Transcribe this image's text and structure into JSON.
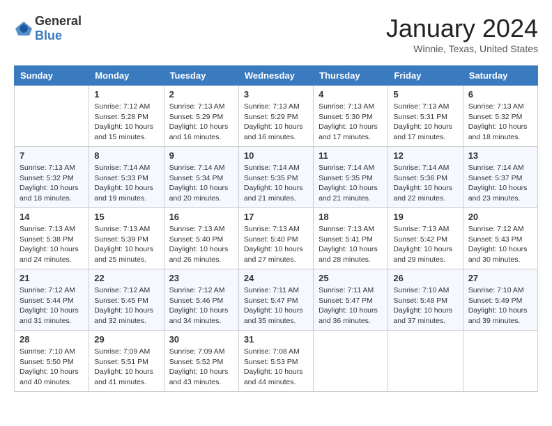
{
  "header": {
    "logo_general": "General",
    "logo_blue": "Blue",
    "month": "January 2024",
    "location": "Winnie, Texas, United States"
  },
  "days_of_week": [
    "Sunday",
    "Monday",
    "Tuesday",
    "Wednesday",
    "Thursday",
    "Friday",
    "Saturday"
  ],
  "weeks": [
    [
      {
        "day": "",
        "info": ""
      },
      {
        "day": "1",
        "info": "Sunrise: 7:12 AM\nSunset: 5:28 PM\nDaylight: 10 hours\nand 15 minutes."
      },
      {
        "day": "2",
        "info": "Sunrise: 7:13 AM\nSunset: 5:29 PM\nDaylight: 10 hours\nand 16 minutes."
      },
      {
        "day": "3",
        "info": "Sunrise: 7:13 AM\nSunset: 5:29 PM\nDaylight: 10 hours\nand 16 minutes."
      },
      {
        "day": "4",
        "info": "Sunrise: 7:13 AM\nSunset: 5:30 PM\nDaylight: 10 hours\nand 17 minutes."
      },
      {
        "day": "5",
        "info": "Sunrise: 7:13 AM\nSunset: 5:31 PM\nDaylight: 10 hours\nand 17 minutes."
      },
      {
        "day": "6",
        "info": "Sunrise: 7:13 AM\nSunset: 5:32 PM\nDaylight: 10 hours\nand 18 minutes."
      }
    ],
    [
      {
        "day": "7",
        "info": "Sunrise: 7:13 AM\nSunset: 5:32 PM\nDaylight: 10 hours\nand 18 minutes."
      },
      {
        "day": "8",
        "info": "Sunrise: 7:14 AM\nSunset: 5:33 PM\nDaylight: 10 hours\nand 19 minutes."
      },
      {
        "day": "9",
        "info": "Sunrise: 7:14 AM\nSunset: 5:34 PM\nDaylight: 10 hours\nand 20 minutes."
      },
      {
        "day": "10",
        "info": "Sunrise: 7:14 AM\nSunset: 5:35 PM\nDaylight: 10 hours\nand 21 minutes."
      },
      {
        "day": "11",
        "info": "Sunrise: 7:14 AM\nSunset: 5:35 PM\nDaylight: 10 hours\nand 21 minutes."
      },
      {
        "day": "12",
        "info": "Sunrise: 7:14 AM\nSunset: 5:36 PM\nDaylight: 10 hours\nand 22 minutes."
      },
      {
        "day": "13",
        "info": "Sunrise: 7:14 AM\nSunset: 5:37 PM\nDaylight: 10 hours\nand 23 minutes."
      }
    ],
    [
      {
        "day": "14",
        "info": "Sunrise: 7:13 AM\nSunset: 5:38 PM\nDaylight: 10 hours\nand 24 minutes."
      },
      {
        "day": "15",
        "info": "Sunrise: 7:13 AM\nSunset: 5:39 PM\nDaylight: 10 hours\nand 25 minutes."
      },
      {
        "day": "16",
        "info": "Sunrise: 7:13 AM\nSunset: 5:40 PM\nDaylight: 10 hours\nand 26 minutes."
      },
      {
        "day": "17",
        "info": "Sunrise: 7:13 AM\nSunset: 5:40 PM\nDaylight: 10 hours\nand 27 minutes."
      },
      {
        "day": "18",
        "info": "Sunrise: 7:13 AM\nSunset: 5:41 PM\nDaylight: 10 hours\nand 28 minutes."
      },
      {
        "day": "19",
        "info": "Sunrise: 7:13 AM\nSunset: 5:42 PM\nDaylight: 10 hours\nand 29 minutes."
      },
      {
        "day": "20",
        "info": "Sunrise: 7:12 AM\nSunset: 5:43 PM\nDaylight: 10 hours\nand 30 minutes."
      }
    ],
    [
      {
        "day": "21",
        "info": "Sunrise: 7:12 AM\nSunset: 5:44 PM\nDaylight: 10 hours\nand 31 minutes."
      },
      {
        "day": "22",
        "info": "Sunrise: 7:12 AM\nSunset: 5:45 PM\nDaylight: 10 hours\nand 32 minutes."
      },
      {
        "day": "23",
        "info": "Sunrise: 7:12 AM\nSunset: 5:46 PM\nDaylight: 10 hours\nand 34 minutes."
      },
      {
        "day": "24",
        "info": "Sunrise: 7:11 AM\nSunset: 5:47 PM\nDaylight: 10 hours\nand 35 minutes."
      },
      {
        "day": "25",
        "info": "Sunrise: 7:11 AM\nSunset: 5:47 PM\nDaylight: 10 hours\nand 36 minutes."
      },
      {
        "day": "26",
        "info": "Sunrise: 7:10 AM\nSunset: 5:48 PM\nDaylight: 10 hours\nand 37 minutes."
      },
      {
        "day": "27",
        "info": "Sunrise: 7:10 AM\nSunset: 5:49 PM\nDaylight: 10 hours\nand 39 minutes."
      }
    ],
    [
      {
        "day": "28",
        "info": "Sunrise: 7:10 AM\nSunset: 5:50 PM\nDaylight: 10 hours\nand 40 minutes."
      },
      {
        "day": "29",
        "info": "Sunrise: 7:09 AM\nSunset: 5:51 PM\nDaylight: 10 hours\nand 41 minutes."
      },
      {
        "day": "30",
        "info": "Sunrise: 7:09 AM\nSunset: 5:52 PM\nDaylight: 10 hours\nand 43 minutes."
      },
      {
        "day": "31",
        "info": "Sunrise: 7:08 AM\nSunset: 5:53 PM\nDaylight: 10 hours\nand 44 minutes."
      },
      {
        "day": "",
        "info": ""
      },
      {
        "day": "",
        "info": ""
      },
      {
        "day": "",
        "info": ""
      }
    ]
  ]
}
